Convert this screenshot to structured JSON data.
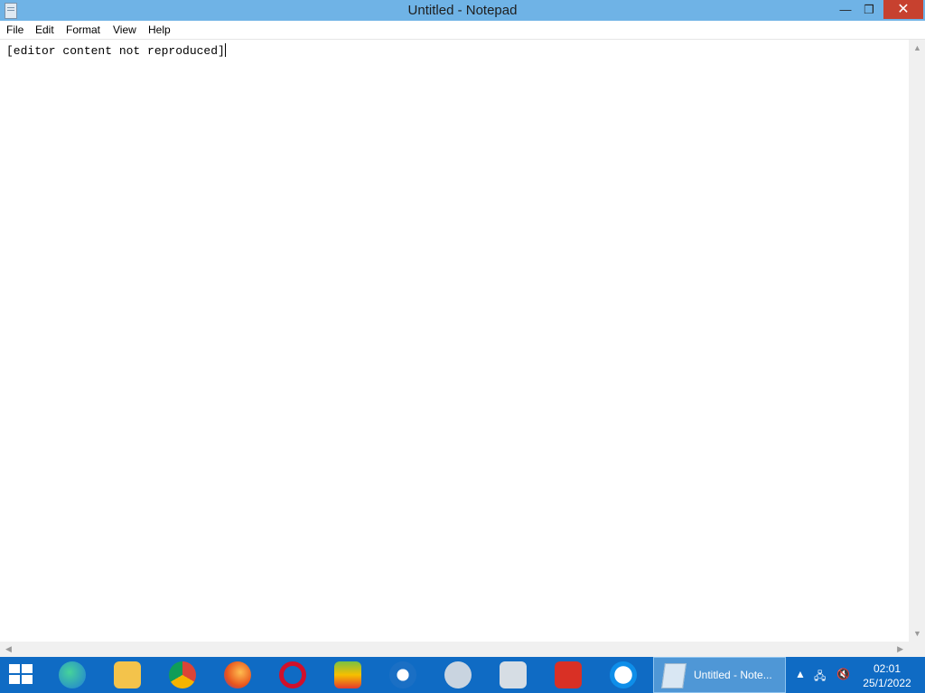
{
  "window": {
    "title": "Untitled - Notepad"
  },
  "menu": [
    "File",
    "Edit",
    "Format",
    "View",
    "Help"
  ],
  "editor": {
    "lines": [
      "[editor content not reproduced]"
    ]
  },
  "taskbar": {
    "pinned": [
      "start-icon",
      "edge-icon",
      "file-explorer-icon",
      "chrome-icon",
      "firefox-icon",
      "opera-icon",
      "bluestacks-icon",
      "thunderbird-icon",
      "network-sniffer-icon",
      "system-monitor-icon",
      "wps-office-icon",
      "teamviewer-icon"
    ],
    "active_task": "Untitled - Note...",
    "clock_time": "02:01",
    "clock_date": "25/1/2022"
  }
}
